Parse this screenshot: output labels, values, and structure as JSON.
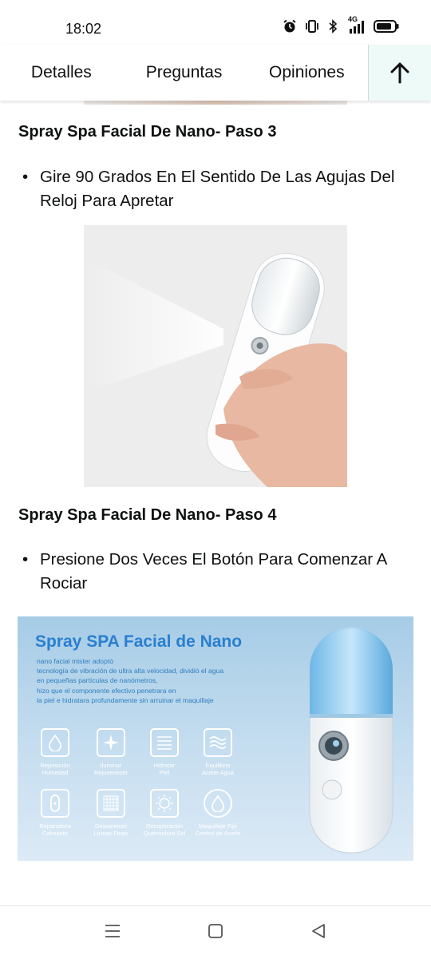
{
  "status": {
    "time": "18:02",
    "network": "4G"
  },
  "tabs": [
    {
      "label": "Detalles"
    },
    {
      "label": "Preguntas"
    },
    {
      "label": "Opiniones"
    }
  ],
  "sections": [
    {
      "heading": "Spray Spa Facial De Nano- Paso 3",
      "bullet": "Gire 90 Grados En El Sentido De Las Agujas Del Reloj Para Apretar"
    },
    {
      "heading": "Spray Spa Facial De Nano- Paso 4",
      "bullet": "Presione Dos Veces El Botón Para Comenzar A Rociar"
    }
  ],
  "banner": {
    "title": "Spray SPA Facial de Nano",
    "description": [
      "nano facial mister adoptó",
      "tecnología de vibración de ultra alta velocidad, dividió el agua",
      "en pequeñas partículas de nanómetros,",
      "hizo que el componente efectivo penetrara en",
      "la piel e hidratara profundamente sin arruinar el maquillaje"
    ],
    "features": [
      {
        "icon": "water-drop-icon",
        "label_1": "Reposición",
        "label_2": "Humedad"
      },
      {
        "icon": "sparkle-icon",
        "label_1": "Iluminar",
        "label_2": "Rejuvenecer"
      },
      {
        "icon": "lines-icon",
        "label_1": "Hidratar",
        "label_2": "Piel"
      },
      {
        "icon": "waves-icon",
        "label_1": "Equilibrio",
        "label_2": "Aceite Agua"
      },
      {
        "icon": "bandage-icon",
        "label_1": "Reparadora",
        "label_2": "Calmante"
      },
      {
        "icon": "grid-icon",
        "label_1": "Desvanecer",
        "label_2": "Líneas Finas"
      },
      {
        "icon": "sun-icon",
        "label_1": "Recuperación",
        "label_2": "Quemadura Sol"
      },
      {
        "icon": "drop-outline-icon",
        "label_1": "Maquillaje Fijo",
        "label_2": "Control de Aceite"
      }
    ]
  },
  "colors": {
    "accent_tab_bg": "#eefaf7",
    "banner_title": "#2a7fd0"
  }
}
